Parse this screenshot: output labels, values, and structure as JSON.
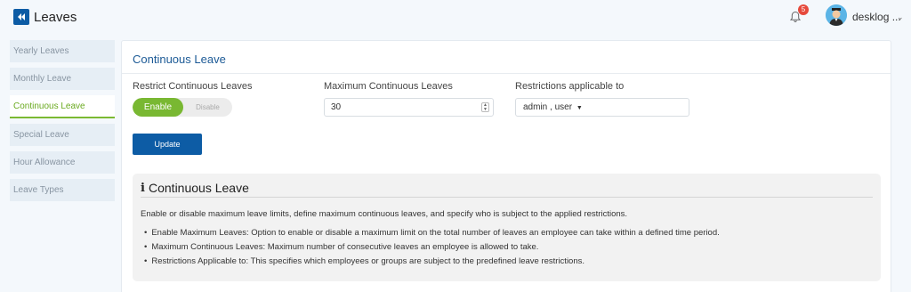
{
  "header": {
    "app_title": "Leaves",
    "notification_count": "5",
    "user_name": "desklog ..."
  },
  "sidebar": {
    "items": [
      {
        "label": "Yearly Leaves"
      },
      {
        "label": "Monthly Leave"
      },
      {
        "label": "Continuous Leave"
      },
      {
        "label": "Special Leave"
      },
      {
        "label": "Hour Allowance"
      },
      {
        "label": "Leave Types"
      }
    ],
    "active_index": 2
  },
  "main": {
    "title": "Continuous Leave",
    "restrict_label": "Restrict Continuous Leaves",
    "toggle_on_label": "Enable",
    "toggle_off_label": "Disable",
    "max_label": "Maximum Continuous Leaves",
    "max_value": "30",
    "restrictions_label": "Restrictions applicable to",
    "restrictions_value": "admin , user",
    "update_label": "Update"
  },
  "info": {
    "title": "Continuous Leave",
    "description": "Enable or disable maximum leave limits, define maximum continuous leaves, and specify who is subject to the applied restrictions.",
    "bullets": [
      "Enable Maximum Leaves: Option to enable or disable a maximum limit on the total number of leaves an employee can take within a defined time period.",
      "Maximum Continuous Leaves: Maximum number of consecutive leaves an employee is allowed to take.",
      "Restrictions Applicable to: This specifies which employees or groups are subject to the predefined leave restrictions."
    ]
  },
  "colors": {
    "primary": "#0d5ca5",
    "accent_green": "#79b832",
    "title_blue": "#1c5a96",
    "badge_red": "#e64a3c"
  }
}
